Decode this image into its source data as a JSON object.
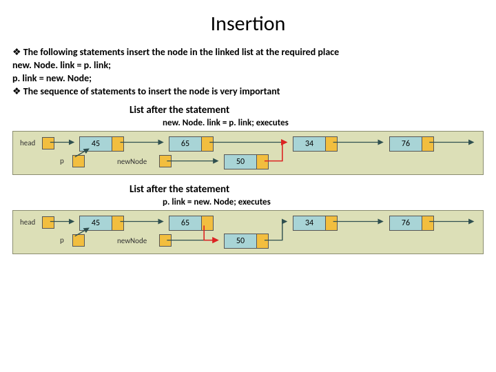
{
  "title": "Insertion",
  "body": {
    "b1": "The following statements insert the node in the  linked list at the required place",
    "code1": " new. Node. link = p. link;",
    "code2": "p. link = new. Node;",
    "b2": "The sequence of statements to insert the node is very  important"
  },
  "fig1": {
    "heading": "List after the statement",
    "caption": "new. Node. link = p. link;  executes",
    "labels": {
      "head": "head",
      "p": "p",
      "new": "newNode"
    },
    "nodes": [
      "45",
      "65",
      "34",
      "76"
    ],
    "newNode": "50"
  },
  "fig2": {
    "heading": "List after the statement",
    "caption": "  p. link = new. Node;  executes",
    "labels": {
      "head": "head",
      "p": "p",
      "new": "newNode"
    },
    "nodes": [
      "45",
      "65",
      "34",
      "76"
    ],
    "newNode": "50"
  },
  "chart_data": [
    {
      "type": "diagram",
      "title": "Linked list after newNode.link = p.link executes",
      "list": [
        45,
        65,
        34,
        76
      ],
      "pointers": {
        "head": 45,
        "p": 45,
        "newNode": 50
      },
      "new_edges": [
        [
          "newNode.link",
          34
        ]
      ],
      "existing_edges": [
        [
          "head",
          45
        ],
        [
          45,
          65
        ],
        [
          65,
          34
        ],
        [
          34,
          76
        ],
        [
          76,
          "null"
        ],
        [
          "p",
          45
        ]
      ]
    },
    {
      "type": "diagram",
      "title": "Linked list after p.link = newNode executes",
      "list": [
        45,
        65,
        50,
        34,
        76
      ],
      "pointers": {
        "head": 45,
        "p": 45,
        "newNode": 50
      },
      "new_edges": [
        [
          "p.link=65.link",
          50
        ]
      ],
      "existing_edges": [
        [
          "head",
          45
        ],
        [
          45,
          65
        ],
        [
          50,
          34
        ],
        [
          34,
          76
        ],
        [
          76,
          "null"
        ]
      ]
    }
  ]
}
